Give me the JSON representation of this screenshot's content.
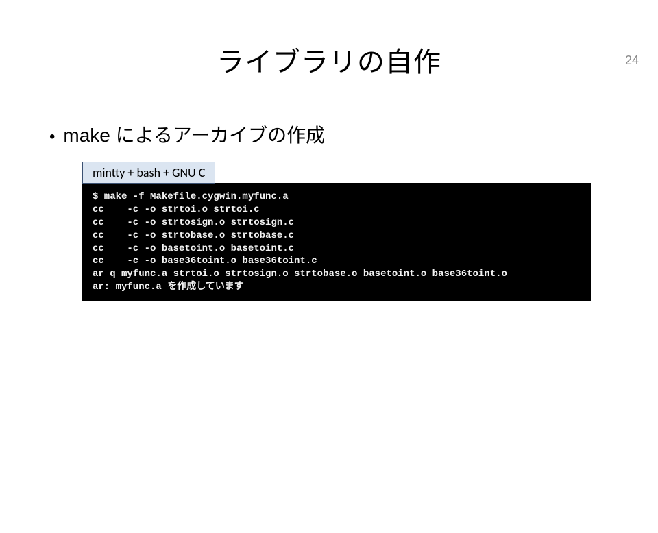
{
  "pageNumber": "24",
  "title": "ライブラリの自作",
  "bulletText": "make によるアーカイブの作成",
  "terminalLabel": "mintty + bash + GNU C",
  "terminalLines": [
    "$ make -f Makefile.cygwin.myfunc.a",
    "cc    -c -o strtoi.o strtoi.c",
    "cc    -c -o strtosign.o strtosign.c",
    "cc    -c -o strtobase.o strtobase.c",
    "cc    -c -o basetoint.o basetoint.c",
    "cc    -c -o base36toint.o base36toint.c",
    "ar q myfunc.a strtoi.o strtosign.o strtobase.o basetoint.o base36toint.o",
    "ar: myfunc.a を作成しています"
  ]
}
